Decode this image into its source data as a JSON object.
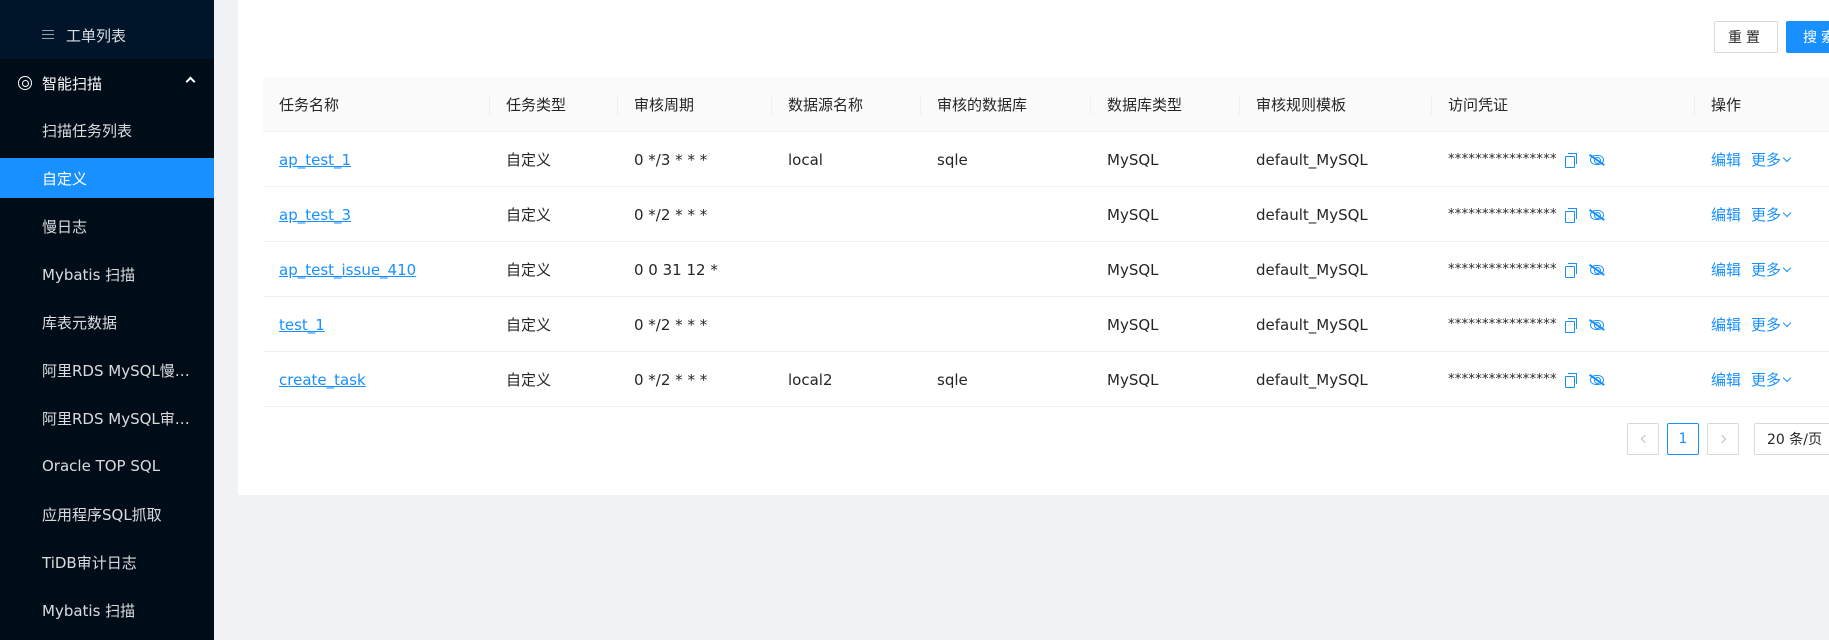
{
  "sidebar": {
    "top_item": {
      "label": "工单列表",
      "icon": "list-icon"
    },
    "group": {
      "label": "智能扫描",
      "icon": "scan-icon"
    },
    "items": [
      {
        "label": "扫描任务列表",
        "selected": false
      },
      {
        "label": "自定义",
        "selected": true
      },
      {
        "label": "慢日志",
        "selected": false
      },
      {
        "label": "Mybatis 扫描",
        "selected": false
      },
      {
        "label": "库表元数据",
        "selected": false
      },
      {
        "label": "阿里RDS MySQL慢日志",
        "selected": false
      },
      {
        "label": "阿里RDS MySQL审计...",
        "selected": false
      },
      {
        "label": "Oracle TOP SQL",
        "selected": false
      },
      {
        "label": "应用程序SQL抓取",
        "selected": false
      },
      {
        "label": "TiDB审计日志",
        "selected": false
      },
      {
        "label": "Mybatis 扫描",
        "selected": false
      }
    ]
  },
  "toolbar": {
    "reset_label": "重置",
    "search_label": "搜索"
  },
  "table": {
    "columns": [
      "任务名称",
      "任务类型",
      "审核周期",
      "数据源名称",
      "审核的数据库",
      "数据库类型",
      "审核规则模板",
      "访问凭证",
      "操作"
    ],
    "rows": [
      {
        "name": "ap_test_1",
        "type": "自定义",
        "cron": "0 */3 * * *",
        "source": "local",
        "database": "sqle",
        "db_type": "MySQL",
        "template": "default_MySQL",
        "token": "****************"
      },
      {
        "name": "ap_test_3",
        "type": "自定义",
        "cron": "0 */2 * * *",
        "source": "",
        "database": "",
        "db_type": "MySQL",
        "template": "default_MySQL",
        "token": "****************"
      },
      {
        "name": "ap_test_issue_410",
        "type": "自定义",
        "cron": "0 0 31 12 *",
        "source": "",
        "database": "",
        "db_type": "MySQL",
        "template": "default_MySQL",
        "token": "****************"
      },
      {
        "name": "test_1",
        "type": "自定义",
        "cron": "0 */2 * * *",
        "source": "",
        "database": "",
        "db_type": "MySQL",
        "template": "default_MySQL",
        "token": "****************"
      },
      {
        "name": "create_task",
        "type": "自定义",
        "cron": "0 */2 * * *",
        "source": "local2",
        "database": "sqle",
        "db_type": "MySQL",
        "template": "default_MySQL",
        "token": "****************"
      }
    ],
    "actions": {
      "edit_label": "编辑",
      "more_label": "更多"
    }
  },
  "pagination": {
    "current_page": "1",
    "page_size_label": "20 条/页"
  },
  "colors": {
    "sidebar_bg": "#001529",
    "submenu_bg": "#000c17",
    "accent": "#1890ff"
  }
}
